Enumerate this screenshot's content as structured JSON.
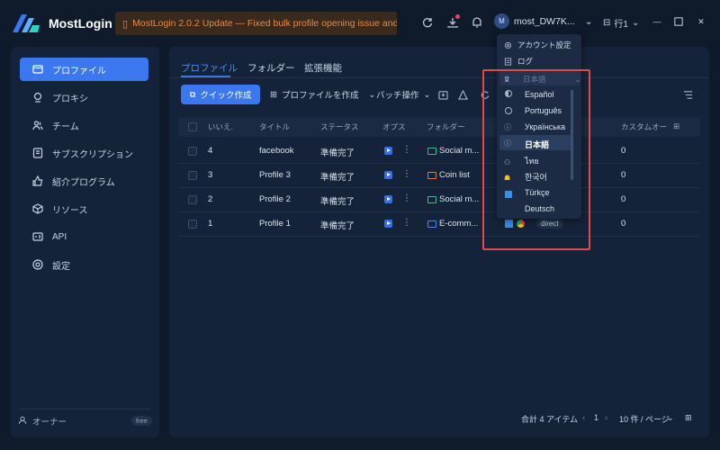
{
  "app": {
    "name": "MostLogin"
  },
  "banner": {
    "text": "MostLogin 2.0.2 Update — Fixed bulk profile opening issue and..."
  },
  "header": {
    "user": "most_DW7K...",
    "avatar_initial": "M",
    "rows_label": "行1"
  },
  "sidebar": {
    "items": [
      {
        "label": "プロファイル",
        "icon": "profile-icon"
      },
      {
        "label": "プロキシ",
        "icon": "proxy-icon"
      },
      {
        "label": "チーム",
        "icon": "team-icon"
      },
      {
        "label": "サブスクリプション",
        "icon": "subscription-icon"
      },
      {
        "label": "紹介プログラム",
        "icon": "referral-icon"
      },
      {
        "label": "リソース",
        "icon": "resource-icon"
      },
      {
        "label": "API",
        "icon": "api-icon"
      },
      {
        "label": "設定",
        "icon": "settings-icon"
      }
    ],
    "owner": "オーナー",
    "plan": "free"
  },
  "tabs": [
    "プロファイル",
    "フォルダー",
    "拡張機能"
  ],
  "toolbar": {
    "quick_create": "クイック作成",
    "create_profile": "プロファイルを作成",
    "batch": "バッチ操作"
  },
  "table": {
    "headers": [
      "いいえ.",
      "タイトル",
      "ステータス",
      "オプス",
      "フォルダー",
      "カスタムオー"
    ],
    "rows": [
      {
        "no": "4",
        "title": "facebook",
        "status": "準備完了",
        "folder": "Social m...",
        "custom": "0"
      },
      {
        "no": "3",
        "title": "Profile 3",
        "status": "準備完了",
        "folder": "Coin list",
        "custom": "0"
      },
      {
        "no": "2",
        "title": "Profile 2",
        "status": "準備完了",
        "folder": "Social m...",
        "custom": "0"
      },
      {
        "no": "1",
        "title": "Profile 1",
        "status": "準備完了",
        "folder": "E-comm...",
        "custom": "0"
      }
    ],
    "proxy_tag": "direct"
  },
  "footer": {
    "total": "合計 4 アイテム",
    "page": "1",
    "per_page": "10 件 / ページ"
  },
  "dropdown": {
    "account_settings": "アカウント設定",
    "logs": "ログ",
    "language_selected": "日本語",
    "languages": [
      "Español",
      "Português",
      "Українська",
      "日本語",
      "ไทย",
      "한국어",
      "Türkçe",
      "Deutsch"
    ]
  },
  "colors": {
    "accent": "#3b78f0",
    "banner_text": "#e28a4a",
    "highlight_box": "#e04a4a"
  }
}
